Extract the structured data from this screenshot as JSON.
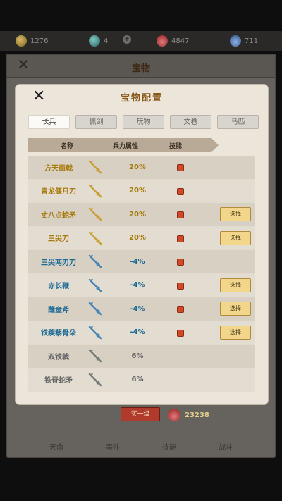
{
  "resources": [
    {
      "name": "coin-icon",
      "value": "1276"
    },
    {
      "name": "jade-icon",
      "value": "4"
    },
    {
      "name": "fire-icon",
      "value": "4847"
    },
    {
      "name": "drop-icon",
      "value": "711"
    }
  ],
  "back_panel": {
    "title": "宝物",
    "tabs": [
      "天命",
      "事件",
      "技能",
      "战斗"
    ]
  },
  "modal": {
    "title": "宝物配置",
    "tabs": [
      "长兵",
      "佩剑",
      "玩物",
      "文卷",
      "马匹"
    ],
    "active_tab": "长兵",
    "columns": [
      "名称",
      "兵力属性",
      "技能"
    ],
    "select_label": "选择",
    "rows": [
      {
        "name": "方天画戟",
        "attr": "20%",
        "tier": "gold",
        "skill": true,
        "select": false
      },
      {
        "name": "青龙偃月刀",
        "attr": "20%",
        "tier": "gold",
        "skill": true,
        "select": false
      },
      {
        "name": "丈八点蛇矛",
        "attr": "20%",
        "tier": "gold",
        "skill": true,
        "select": true
      },
      {
        "name": "三尖刀",
        "attr": "20%",
        "tier": "gold",
        "skill": true,
        "select": true
      },
      {
        "name": "三尖两刃刀",
        "attr": "-4%",
        "tier": "blue",
        "skill": true,
        "select": false
      },
      {
        "name": "赤长鞭",
        "attr": "-4%",
        "tier": "blue",
        "skill": true,
        "select": true
      },
      {
        "name": "蘸金斧",
        "attr": "-4%",
        "tier": "blue",
        "skill": true,
        "select": true
      },
      {
        "name": "铁蒺藜骨朵",
        "attr": "-4%",
        "tier": "blue",
        "skill": true,
        "select": true
      },
      {
        "name": "双铁戟",
        "attr": "6%",
        "tier": "gray",
        "skill": false,
        "select": false
      },
      {
        "name": "铁脊蛇矛",
        "attr": "6%",
        "tier": "gray",
        "skill": false,
        "select": false
      }
    ],
    "buy_label": "买一级",
    "cost_value": "23238"
  },
  "colors": {
    "gold_text": "#a87a0c",
    "blue_text": "#1e6b95",
    "gray_text": "#666666",
    "buy_button": "#b03a2c",
    "select_button": "#f2d68b"
  }
}
